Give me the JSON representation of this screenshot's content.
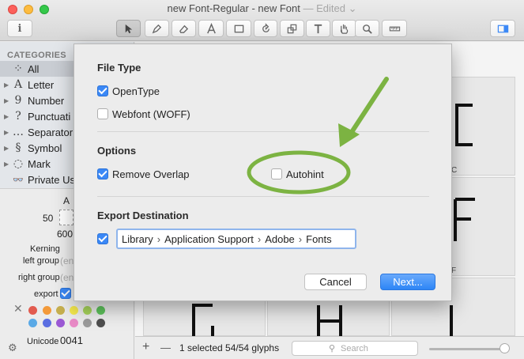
{
  "window": {
    "title": "new Font-Regular - new Font",
    "title_suffix": "— Edited",
    "chevron": "⌄"
  },
  "toolbar": {
    "info_label": "i",
    "tools": [
      "pointer",
      "pen",
      "eraser",
      "text-a",
      "rectangle",
      "rotate",
      "scale",
      "text-t",
      "hand",
      "magnify",
      "ruler"
    ],
    "panel_toggle": "sidebar-toggle"
  },
  "sidebar": {
    "header": "CATEGORIES",
    "items": [
      {
        "glyph": "⁘",
        "label": "All",
        "selected": true
      },
      {
        "glyph": "A",
        "label": "Letter"
      },
      {
        "glyph": "9",
        "label": "Number"
      },
      {
        "glyph": "?",
        "label": "Punctuati"
      },
      {
        "glyph": "…",
        "label": "Separator"
      },
      {
        "glyph": "§",
        "label": "Symbol"
      },
      {
        "glyph": "◌",
        "label": "Mark"
      },
      {
        "glyph": "👓",
        "label": "Private Us"
      }
    ]
  },
  "info_panel": {
    "glyph_name": "A",
    "left_num": "50",
    "width_num": "600",
    "kerning": "Kerning",
    "left_group": "left group",
    "left_group_value": "(en",
    "right_group": "right group",
    "right_group_value": "(en",
    "export": "export",
    "unicode_label": "Unicode",
    "unicode_value": "0041",
    "colors": [
      "#e25b4f",
      "#f39a3a",
      "#c7b04f",
      "#f5e94d",
      "#a7d45b",
      "#5ec35c",
      "#5aa9e6",
      "#5b6ee1",
      "#9b59d4",
      "#e98bc7",
      "#9b9b9b",
      "#4e4e4e"
    ]
  },
  "grid": {
    "glyph_labels": [
      "C",
      "F"
    ]
  },
  "bottombar": {
    "plus": "+",
    "minus": "—",
    "status": "1 selected 54/54 glyphs",
    "search_placeholder": "Search",
    "zoom_level": 0.95
  },
  "dialog": {
    "file_type": {
      "title": "File Type",
      "opentype": {
        "label": "OpenType",
        "checked": true
      },
      "webfont": {
        "label": "Webfont (WOFF)",
        "checked": false
      }
    },
    "options": {
      "title": "Options",
      "remove_overlap": {
        "label": "Remove Overlap",
        "checked": true
      },
      "autohint": {
        "label": "Autohint",
        "checked": false
      }
    },
    "export_destination": {
      "title": "Export Destination",
      "checked": true,
      "path": [
        "Library",
        "Application Support",
        "Adobe",
        "Fonts"
      ],
      "separator": "›"
    },
    "cancel_label": "Cancel",
    "next_label": "Next..."
  },
  "annotation": {
    "color": "#7cb342"
  }
}
